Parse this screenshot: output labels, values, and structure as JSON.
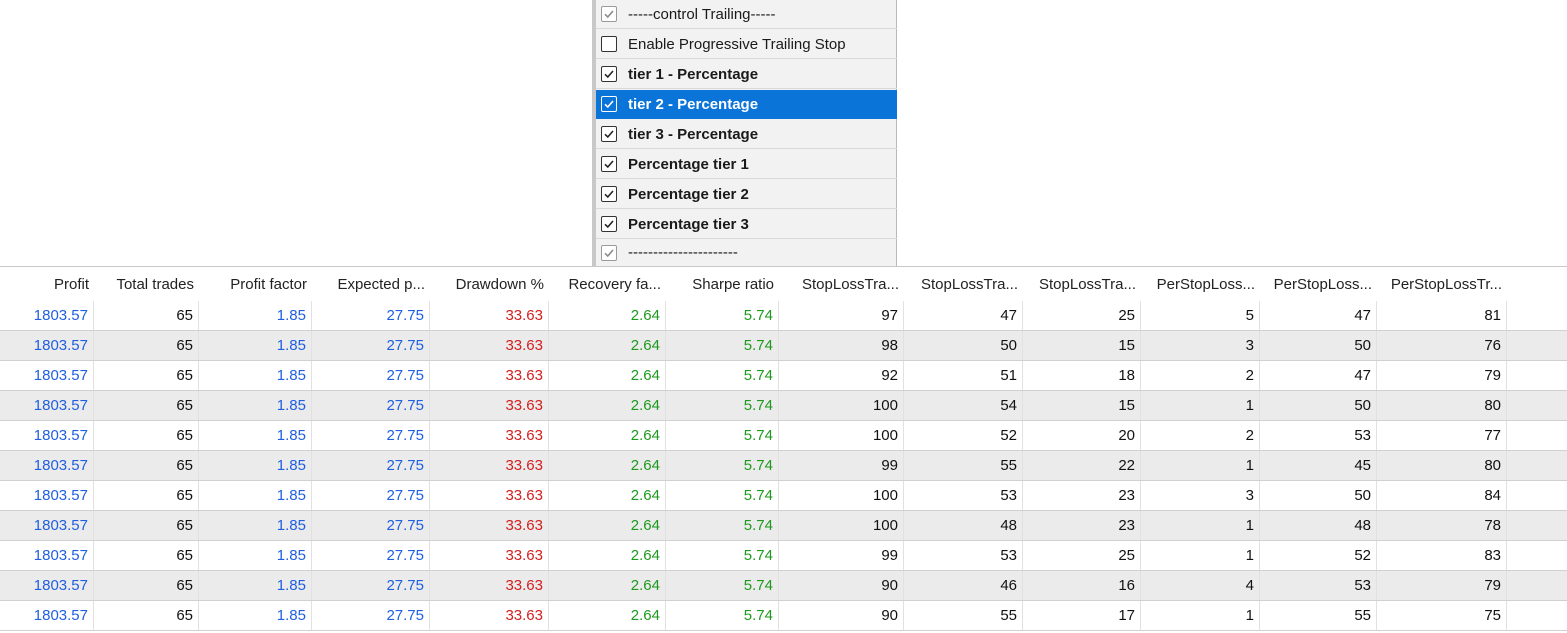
{
  "dropdown": {
    "items": [
      {
        "label": "-----control Trailing-----",
        "checked": true,
        "bold": false,
        "selected": false,
        "dim": true
      },
      {
        "label": "Enable Progressive Trailing Stop",
        "checked": false,
        "bold": false,
        "selected": false,
        "dim": false
      },
      {
        "label": "tier 1 - Percentage",
        "checked": true,
        "bold": true,
        "selected": false,
        "dim": false
      },
      {
        "label": "tier 2 - Percentage",
        "checked": true,
        "bold": true,
        "selected": true,
        "dim": false
      },
      {
        "label": "tier 3 - Percentage",
        "checked": true,
        "bold": true,
        "selected": false,
        "dim": false
      },
      {
        "label": "Percentage tier 1",
        "checked": true,
        "bold": true,
        "selected": false,
        "dim": false
      },
      {
        "label": "Percentage tier 2",
        "checked": true,
        "bold": true,
        "selected": false,
        "dim": false
      },
      {
        "label": "Percentage tier 3",
        "checked": true,
        "bold": true,
        "selected": false,
        "dim": false
      },
      {
        "label": "----------------------",
        "checked": true,
        "bold": false,
        "selected": false,
        "dim": true
      }
    ]
  },
  "table": {
    "columns": [
      {
        "label": "Profit",
        "color": "blue"
      },
      {
        "label": "Total trades",
        "color": "black"
      },
      {
        "label": "Profit factor",
        "color": "blue"
      },
      {
        "label": "Expected p...",
        "color": "blue"
      },
      {
        "label": "Drawdown %",
        "color": "red"
      },
      {
        "label": "Recovery fa...",
        "color": "green"
      },
      {
        "label": "Sharpe ratio",
        "color": "green"
      },
      {
        "label": "StopLossTra...",
        "color": "black"
      },
      {
        "label": "StopLossTra...",
        "color": "black"
      },
      {
        "label": "StopLossTra...",
        "color": "black"
      },
      {
        "label": "PerStopLoss...",
        "color": "black"
      },
      {
        "label": "PerStopLoss...",
        "color": "black"
      },
      {
        "label": "PerStopLossTr...",
        "color": "black"
      }
    ],
    "rows": [
      [
        "1803.57",
        "65",
        "1.85",
        "27.75",
        "33.63",
        "2.64",
        "5.74",
        "97",
        "47",
        "25",
        "5",
        "47",
        "81"
      ],
      [
        "1803.57",
        "65",
        "1.85",
        "27.75",
        "33.63",
        "2.64",
        "5.74",
        "98",
        "50",
        "15",
        "3",
        "50",
        "76"
      ],
      [
        "1803.57",
        "65",
        "1.85",
        "27.75",
        "33.63",
        "2.64",
        "5.74",
        "92",
        "51",
        "18",
        "2",
        "47",
        "79"
      ],
      [
        "1803.57",
        "65",
        "1.85",
        "27.75",
        "33.63",
        "2.64",
        "5.74",
        "100",
        "54",
        "15",
        "1",
        "50",
        "80"
      ],
      [
        "1803.57",
        "65",
        "1.85",
        "27.75",
        "33.63",
        "2.64",
        "5.74",
        "100",
        "52",
        "20",
        "2",
        "53",
        "77"
      ],
      [
        "1803.57",
        "65",
        "1.85",
        "27.75",
        "33.63",
        "2.64",
        "5.74",
        "99",
        "55",
        "22",
        "1",
        "45",
        "80"
      ],
      [
        "1803.57",
        "65",
        "1.85",
        "27.75",
        "33.63",
        "2.64",
        "5.74",
        "100",
        "53",
        "23",
        "3",
        "50",
        "84"
      ],
      [
        "1803.57",
        "65",
        "1.85",
        "27.75",
        "33.63",
        "2.64",
        "5.74",
        "100",
        "48",
        "23",
        "1",
        "48",
        "78"
      ],
      [
        "1803.57",
        "65",
        "1.85",
        "27.75",
        "33.63",
        "2.64",
        "5.74",
        "99",
        "53",
        "25",
        "1",
        "52",
        "83"
      ],
      [
        "1803.57",
        "65",
        "1.85",
        "27.75",
        "33.63",
        "2.64",
        "5.74",
        "90",
        "46",
        "16",
        "4",
        "53",
        "79"
      ],
      [
        "1803.57",
        "65",
        "1.85",
        "27.75",
        "33.63",
        "2.64",
        "5.74",
        "90",
        "55",
        "17",
        "1",
        "55",
        "75"
      ]
    ]
  },
  "colors": {
    "blue": "#1f5fe0",
    "red": "#d32020",
    "green": "#1d9a1d",
    "black": "#111111",
    "selection": "#0a74d9"
  },
  "icons": {
    "checkbox": "checkbox-icon"
  }
}
